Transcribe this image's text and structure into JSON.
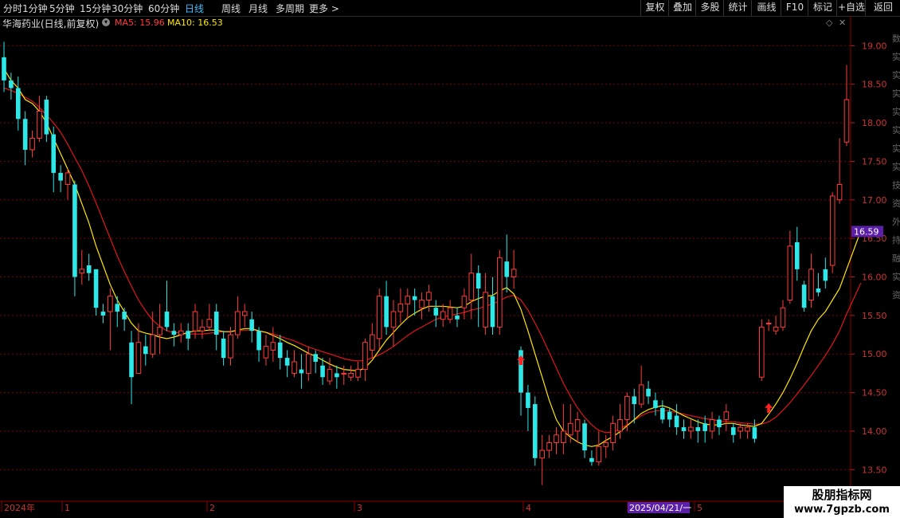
{
  "toolbar": {
    "left": [
      "分时",
      "1分钟",
      "5分钟",
      "15分钟",
      "30分钟",
      "60分钟",
      "日线",
      "周线",
      "月线",
      "多周期",
      "更多 >"
    ],
    "active": "日线",
    "right": [
      "复权",
      "叠加",
      "多股",
      "统计",
      "画线",
      "F10",
      "标记",
      "+自选",
      "返回"
    ]
  },
  "info": {
    "title": "华海药业(日线,前复权)",
    "ma5": "MA5: 15.96",
    "ma10": "MA10: 16.53",
    "ma5_color": "#ff3b3b",
    "ma10_color": "#ffe600"
  },
  "chart_data": {
    "type": "candlestick",
    "ylim": [
      13.1,
      19.2
    ],
    "yticks": [
      "19.00",
      "18.50",
      "18.00",
      "17.50",
      "17.00",
      "16.50",
      "16.00",
      "15.50",
      "15.00",
      "14.50",
      "14.00",
      "13.50"
    ],
    "current_price_label": "16.59",
    "current_price": 16.59,
    "x_labels": [
      "2024年",
      "1",
      "2",
      "3",
      "4",
      "2025/04/21/一",
      "5"
    ],
    "up_color": "#ff3b3b",
    "down_color": "#2ee8e8",
    "ma_fast_color": "#ffe600",
    "ma_slow_color": "#e01515",
    "candles": [
      [
        18.85,
        18.55,
        19.05,
        18.4
      ],
      [
        18.55,
        18.45,
        18.65,
        18.3
      ],
      [
        18.45,
        18.05,
        18.6,
        17.9
      ],
      [
        18.05,
        17.65,
        18.15,
        17.45
      ],
      [
        17.65,
        17.8,
        17.9,
        17.55
      ],
      [
        17.8,
        18.15,
        18.35,
        17.75
      ],
      [
        18.3,
        17.85,
        18.35,
        17.75
      ],
      [
        17.85,
        17.35,
        17.95,
        17.1
      ],
      [
        17.35,
        17.25,
        17.45,
        17.1
      ],
      [
        17.2,
        17.35,
        17.4,
        17.0
      ],
      [
        17.2,
        16.0,
        17.25,
        15.75
      ],
      [
        16.05,
        16.1,
        16.35,
        15.9
      ],
      [
        16.15,
        16.05,
        16.3,
        15.95
      ],
      [
        16.1,
        15.6,
        16.1,
        15.5
      ],
      [
        15.55,
        15.5,
        15.65,
        15.4
      ],
      [
        15.55,
        15.75,
        15.85,
        15.05
      ],
      [
        15.65,
        15.55,
        15.75,
        15.35
      ],
      [
        15.55,
        15.45,
        15.6,
        15.3
      ],
      [
        15.15,
        14.7,
        15.3,
        14.35
      ],
      [
        14.75,
        15.15,
        15.4,
        14.75
      ],
      [
        15.1,
        15.0,
        15.25,
        14.85
      ],
      [
        15.0,
        15.25,
        15.55,
        14.95
      ],
      [
        15.25,
        15.35,
        15.65,
        15.0
      ],
      [
        15.55,
        15.35,
        15.95,
        15.3
      ],
      [
        15.3,
        15.25,
        15.4,
        15.1
      ],
      [
        15.25,
        15.3,
        15.4,
        15.15
      ],
      [
        15.3,
        15.2,
        15.4,
        15.05
      ],
      [
        15.3,
        15.55,
        15.65,
        15.2
      ],
      [
        15.3,
        15.35,
        15.45,
        15.2
      ],
      [
        15.35,
        15.45,
        15.65,
        15.3
      ],
      [
        15.55,
        15.25,
        15.65,
        15.05
      ],
      [
        15.2,
        14.95,
        15.3,
        14.85
      ],
      [
        14.95,
        15.25,
        15.35,
        14.85
      ],
      [
        15.25,
        15.55,
        15.75,
        15.2
      ],
      [
        15.5,
        15.55,
        15.65,
        15.35
      ],
      [
        15.45,
        15.3,
        15.55,
        15.15
      ],
      [
        15.3,
        15.05,
        15.35,
        14.9
      ],
      [
        14.95,
        15.1,
        15.25,
        14.85
      ],
      [
        15.05,
        15.15,
        15.35,
        14.9
      ],
      [
        15.15,
        14.95,
        15.25,
        14.8
      ],
      [
        14.95,
        14.85,
        15.05,
        14.7
      ],
      [
        14.75,
        14.9,
        15.05,
        14.7
      ],
      [
        14.8,
        14.75,
        15.0,
        14.55
      ],
      [
        14.75,
        15.0,
        15.1,
        14.65
      ],
      [
        15.0,
        14.9,
        15.05,
        14.75
      ],
      [
        14.85,
        14.7,
        14.95,
        14.6
      ],
      [
        14.65,
        14.8,
        14.95,
        14.6
      ],
      [
        14.75,
        14.7,
        14.85,
        14.55
      ],
      [
        14.75,
        14.75,
        14.85,
        14.6
      ],
      [
        14.7,
        14.75,
        14.85,
        14.65
      ],
      [
        14.7,
        14.8,
        14.9,
        14.65
      ],
      [
        14.8,
        15.15,
        15.2,
        14.65
      ],
      [
        15.05,
        15.25,
        15.4,
        14.95
      ],
      [
        15.2,
        15.75,
        15.85,
        15.05
      ],
      [
        15.75,
        15.35,
        15.95,
        15.25
      ],
      [
        15.35,
        15.55,
        15.7,
        15.1
      ],
      [
        15.55,
        15.65,
        15.85,
        15.4
      ],
      [
        15.65,
        15.75,
        15.85,
        15.45
      ],
      [
        15.75,
        15.7,
        15.85,
        15.5
      ],
      [
        15.6,
        15.7,
        15.8,
        15.45
      ],
      [
        15.7,
        15.8,
        15.9,
        15.55
      ],
      [
        15.6,
        15.5,
        15.7,
        15.35
      ],
      [
        15.45,
        15.55,
        15.65,
        15.35
      ],
      [
        15.45,
        15.6,
        15.7,
        15.4
      ],
      [
        15.5,
        15.45,
        15.6,
        15.35
      ],
      [
        15.6,
        15.75,
        15.85,
        15.45
      ],
      [
        15.7,
        16.05,
        16.3,
        15.45
      ],
      [
        16.05,
        15.85,
        16.15,
        15.35
      ],
      [
        15.35,
        15.8,
        16.05,
        15.25
      ],
      [
        15.75,
        15.35,
        16.0,
        15.25
      ],
      [
        15.35,
        16.25,
        16.35,
        15.25
      ],
      [
        16.2,
        16.0,
        16.55,
        15.8
      ],
      [
        16.0,
        16.1,
        16.35,
        15.85
      ],
      [
        15.05,
        14.5,
        15.1,
        14.2
      ],
      [
        14.5,
        14.3,
        14.6,
        14.0
      ],
      [
        14.35,
        13.65,
        14.45,
        13.55
      ],
      [
        13.65,
        13.75,
        13.95,
        13.3
      ],
      [
        13.75,
        13.85,
        13.95,
        13.65
      ],
      [
        13.85,
        13.95,
        14.05,
        13.7
      ],
      [
        13.85,
        14.0,
        14.35,
        13.7
      ],
      [
        13.95,
        14.1,
        14.35,
        13.85
      ],
      [
        14.0,
        14.15,
        14.25,
        13.85
      ],
      [
        14.1,
        13.75,
        14.15,
        13.65
      ],
      [
        13.65,
        13.6,
        13.75,
        13.55
      ],
      [
        13.6,
        13.8,
        14.0,
        13.55
      ],
      [
        13.8,
        13.85,
        13.95,
        13.65
      ],
      [
        13.85,
        14.1,
        14.2,
        13.75
      ],
      [
        14.0,
        14.15,
        14.35,
        13.9
      ],
      [
        14.15,
        14.45,
        14.5,
        14.0
      ],
      [
        14.45,
        14.35,
        14.55,
        14.1
      ],
      [
        14.35,
        14.6,
        14.85,
        14.3
      ],
      [
        14.55,
        14.45,
        14.65,
        14.35
      ],
      [
        14.4,
        14.3,
        14.5,
        14.2
      ],
      [
        14.3,
        14.15,
        14.4,
        14.1
      ],
      [
        14.25,
        14.15,
        14.3,
        14.05
      ],
      [
        14.2,
        14.05,
        14.35,
        13.95
      ],
      [
        14.05,
        14.0,
        14.15,
        13.9
      ],
      [
        14.0,
        14.05,
        14.15,
        13.9
      ],
      [
        14.05,
        14.0,
        14.15,
        13.85
      ],
      [
        14.1,
        14.0,
        14.2,
        13.85
      ],
      [
        14.0,
        14.15,
        14.25,
        13.9
      ],
      [
        14.15,
        14.05,
        14.2,
        13.95
      ],
      [
        14.15,
        14.25,
        14.35,
        14.0
      ],
      [
        14.05,
        13.95,
        14.1,
        13.85
      ],
      [
        14.0,
        14.05,
        14.1,
        13.9
      ],
      [
        14.0,
        14.05,
        14.1,
        13.9
      ],
      [
        14.05,
        13.9,
        14.15,
        13.85
      ],
      [
        14.7,
        15.35,
        15.45,
        14.65
      ],
      [
        15.4,
        15.4,
        15.45,
        15.3
      ],
      [
        15.3,
        15.35,
        15.5,
        15.25
      ],
      [
        15.35,
        15.6,
        15.7,
        15.3
      ],
      [
        15.7,
        16.4,
        16.6,
        15.65
      ],
      [
        16.45,
        16.1,
        16.65,
        15.95
      ],
      [
        15.9,
        15.6,
        15.95,
        15.55
      ],
      [
        15.7,
        16.1,
        16.3,
        15.6
      ],
      [
        15.85,
        15.8,
        16.05,
        15.75
      ],
      [
        16.1,
        15.95,
        16.25,
        15.85
      ],
      [
        16.15,
        17.05,
        17.1,
        16.05
      ],
      [
        17.0,
        17.2,
        17.8,
        16.95
      ],
      [
        17.75,
        18.3,
        18.75,
        17.7
      ]
    ],
    "ma_fast": [
      18.7,
      18.55,
      18.45,
      18.3,
      18.25,
      18.15,
      18.0,
      17.8,
      17.6,
      17.4,
      17.2,
      16.95,
      16.7,
      16.4,
      16.15,
      15.9,
      15.7,
      15.55,
      15.4,
      15.3,
      15.27,
      15.25,
      15.22,
      15.2,
      15.22,
      15.25,
      15.28,
      15.3,
      15.3,
      15.31,
      15.31,
      15.29,
      15.29,
      15.31,
      15.33,
      15.33,
      15.3,
      15.28,
      15.24,
      15.2,
      15.15,
      15.11,
      15.06,
      15.01,
      14.97,
      14.92,
      14.87,
      14.83,
      14.8,
      14.79,
      14.78,
      14.82,
      14.92,
      15.05,
      15.18,
      15.28,
      15.38,
      15.47,
      15.53,
      15.58,
      15.62,
      15.62,
      15.62,
      15.61,
      15.6,
      15.62,
      15.68,
      15.72,
      15.75,
      15.76,
      15.82,
      15.86,
      15.78,
      15.58,
      15.3,
      15.0,
      14.7,
      14.4,
      14.15,
      14.0,
      13.92,
      13.86,
      13.82,
      13.8,
      13.82,
      13.88,
      13.93,
      13.99,
      14.07,
      14.15,
      14.23,
      14.28,
      14.31,
      14.33,
      14.3,
      14.25,
      14.2,
      14.16,
      14.12,
      14.09,
      14.08,
      14.08,
      14.1,
      14.1,
      14.08,
      14.07,
      14.06,
      14.1,
      14.22,
      14.35,
      14.5,
      14.68,
      14.88,
      15.1,
      15.3,
      15.45,
      15.55,
      15.7,
      15.85,
      16.1,
      16.35,
      16.6
    ],
    "ma_slow": [
      18.45,
      18.42,
      18.38,
      18.33,
      18.28,
      18.2,
      18.1,
      18.0,
      17.88,
      17.72,
      17.55,
      17.38,
      17.18,
      16.96,
      16.73,
      16.5,
      16.27,
      16.07,
      15.88,
      15.7,
      15.56,
      15.44,
      15.36,
      15.3,
      15.28,
      15.27,
      15.26,
      15.26,
      15.26,
      15.27,
      15.28,
      15.29,
      15.29,
      15.3,
      15.31,
      15.31,
      15.3,
      15.28,
      15.26,
      15.23,
      15.2,
      15.17,
      15.13,
      15.09,
      15.06,
      15.03,
      15.0,
      14.97,
      14.94,
      14.92,
      14.91,
      14.92,
      14.95,
      14.99,
      15.04,
      15.1,
      15.17,
      15.24,
      15.3,
      15.35,
      15.4,
      15.45,
      15.48,
      15.5,
      15.52,
      15.54,
      15.57,
      15.59,
      15.62,
      15.65,
      15.69,
      15.74,
      15.76,
      15.7,
      15.57,
      15.4,
      15.22,
      15.02,
      14.82,
      14.62,
      14.45,
      14.3,
      14.18,
      14.08,
      14.01,
      13.98,
      13.99,
      14.03,
      14.08,
      14.14,
      14.2,
      14.24,
      14.26,
      14.27,
      14.26,
      14.24,
      14.22,
      14.2,
      14.18,
      14.16,
      14.15,
      14.13,
      14.12,
      14.12,
      14.11,
      14.1,
      14.09,
      14.09,
      14.12,
      14.18,
      14.27,
      14.37,
      14.48,
      14.6,
      14.72,
      14.85,
      14.98,
      15.13,
      15.3,
      15.52,
      15.72,
      15.92
    ],
    "markers": [
      {
        "index": 73,
        "price": 14.92
      },
      {
        "index": 108,
        "price": 14.3
      }
    ]
  },
  "badge": {
    "line1": "股朋指标网",
    "line2": "www.7gpzb.com"
  },
  "right_strip": [
    "数",
    "实",
    "实",
    "实",
    "实",
    "实",
    "实",
    "实",
    "技",
    "资",
    "外",
    "持",
    "融",
    "实",
    "资"
  ]
}
